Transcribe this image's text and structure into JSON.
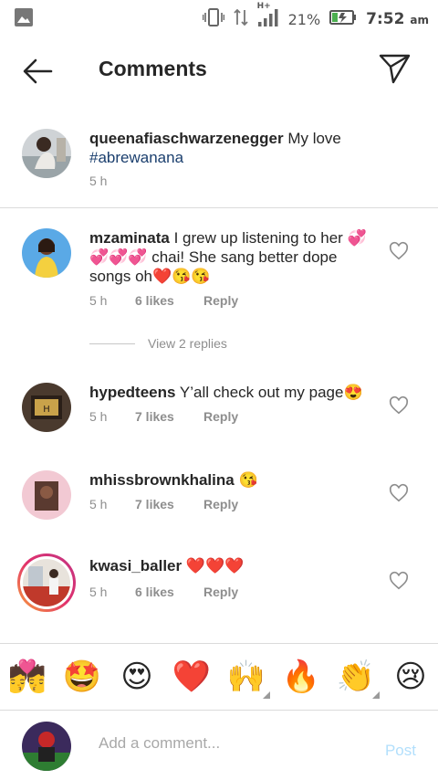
{
  "status_bar": {
    "battery": "21%",
    "time": "7:52",
    "ampm": "am",
    "network": "H+"
  },
  "header": {
    "title": "Comments"
  },
  "caption": {
    "username": "queenafiaschwarzenegger",
    "text": "My love",
    "hashtag": "#abrewanana",
    "time": "5 h"
  },
  "comments": [
    {
      "username": "mzaminata",
      "text": "I grew up listening to her 💞💞💞💞 chai! She sang better dope songs oh❤️😘😘",
      "time": "5 h",
      "likes": "6 likes",
      "reply": "Reply"
    },
    {
      "username": "hypedteens",
      "text": "Y’all check out my page😍",
      "time": "5 h",
      "likes": "7 likes",
      "reply": "Reply"
    },
    {
      "username": "mhissbrownkhalina",
      "text": "😘",
      "time": "5 h",
      "likes": "7 likes",
      "reply": "Reply"
    },
    {
      "username": "kwasi_baller",
      "text": "❤️❤️❤️",
      "time": "5 h",
      "likes": "6 likes",
      "reply": "Reply"
    }
  ],
  "view_replies": "View 2 replies",
  "emoji_bar": [
    "💏",
    "🤩",
    "😍",
    "❤️",
    "🙌",
    "🔥",
    "👏",
    "😢"
  ],
  "add_comment": {
    "placeholder": "Add a comment...",
    "post_label": "Post"
  },
  "colors": {
    "text": "#262626",
    "secondary": "#8e8e8e",
    "hashtag": "#1b3f6e",
    "post_disabled": "#b2dffc",
    "divider": "#dbdbdb"
  },
  "icons": {
    "back": "back-arrow-icon",
    "send": "direct-send-icon",
    "like": "heart-outline-icon",
    "vibrate": "vibrate-icon",
    "signal": "signal-icon",
    "battery": "battery-charging-icon",
    "gallery": "gallery-notification-icon"
  }
}
